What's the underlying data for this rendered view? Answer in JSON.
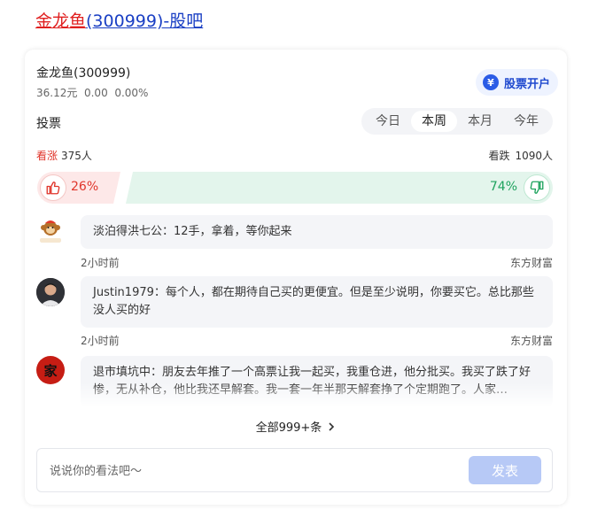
{
  "page_title": {
    "stock_link": "金龙鱼",
    "code_link": "(300999)-股吧"
  },
  "stock": {
    "name": "金龙鱼(300999)",
    "quote": "36.12元  0.00  0.00%"
  },
  "open_account": {
    "icon": "¥",
    "label": "股票开户"
  },
  "vote": {
    "label": "投票",
    "tabs": [
      {
        "label": "今日",
        "active": false
      },
      {
        "label": "本周",
        "active": true
      },
      {
        "label": "本月",
        "active": false
      },
      {
        "label": "今年",
        "active": false
      }
    ],
    "bull_word": "看涨",
    "bull_count": "375人",
    "bear_word": "看跌",
    "bear_count": "1090人",
    "bull_pct": "26%",
    "bear_pct": "74%",
    "bull_fraction": 0.26,
    "colors": {
      "bull": "#e0352b",
      "bear": "#1ea35e"
    }
  },
  "comments": [
    {
      "avatar_icon": "monkey-avatar-icon",
      "text": "淡泊得洪七公：12手，拿着，等你起来",
      "time": "2小时前",
      "source": "东方财富"
    },
    {
      "avatar_icon": "person-avatar-icon",
      "text": "Justin1979：每个人，都在期待自己买的更便宜。但是至少说明，你要买它。总比那些没人买的好",
      "time": "2小时前",
      "source": "东方财富"
    },
    {
      "avatar_icon": "jia-avatar-icon",
      "avatar_char": "家",
      "text": "退市填坑中：朋友去年推了一个高票让我一起买，我重仓进，他分批买。我买了跌了好惨，无从补仓，他比我还早解套。我一套一年半那天解套挣了个定期跑了。人家…"
    }
  ],
  "all_link": "全部999+条",
  "all_link_icon": "chevron-right-icon",
  "comment_input": {
    "placeholder": "说说你的看法吧～",
    "send_label": "发表"
  }
}
